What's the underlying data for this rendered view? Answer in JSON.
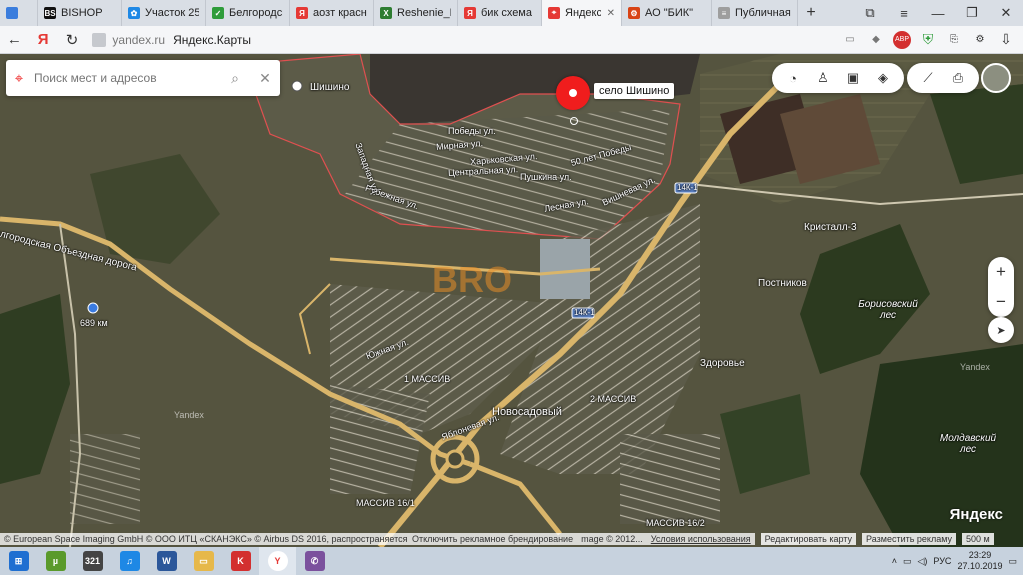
{
  "browser": {
    "tabs": [
      {
        "label": "",
        "favicon_color": "#3b7ddd",
        "favicon_text": ""
      },
      {
        "label": "BISHOP",
        "favicon_color": "#111111",
        "favicon_text": "BS"
      },
      {
        "label": "Участок 25",
        "favicon_color": "#1e88e5",
        "favicon_text": "✿"
      },
      {
        "label": "Белгородск",
        "favicon_color": "#2e9c3a",
        "favicon_text": "✓"
      },
      {
        "label": "аозт красн",
        "favicon_color": "#e53935",
        "favicon_text": "Я"
      },
      {
        "label": "Reshenie_Be",
        "favicon_color": "#2e7d32",
        "favicon_text": "X"
      },
      {
        "label": "бик схема",
        "favicon_color": "#e53935",
        "favicon_text": "Я"
      },
      {
        "label": "Яндекс.К",
        "favicon_color": "#e53935",
        "favicon_text": "⌖"
      },
      {
        "label": "АО \"БИК\"",
        "favicon_color": "#d84315",
        "favicon_text": "⚙"
      },
      {
        "label": "Публичная",
        "favicon_color": "#9e9e9e",
        "favicon_text": "≡"
      }
    ],
    "active_tab_index": 7,
    "new_tab_symbol": "+",
    "url_domain": "yandex.ru",
    "page_title": "Яндекс.Карты",
    "abp_label": "ABP"
  },
  "map": {
    "search_placeholder": "Поиск мест и адресов",
    "selected_place": "село Шишино",
    "labels": {
      "shishino": "Шишино",
      "bypass": "Белгородская Объездная дорога",
      "km689": "689 км",
      "kristall": "Кристалл-3",
      "postnikov": "Постников",
      "borisovsky": "Борисовский лес",
      "zdorovye": "Здоровье",
      "moldavsky": "Молдавский лес",
      "novosadovy": "Новосадовый",
      "massiv1": "1 МАССИВ",
      "massiv2": "2 МАССИВ",
      "massiv16_1": "МАССИВ 16/1",
      "massiv16_2": "МАССИВ 16/2",
      "road14k1": "14К-1",
      "road14k1b": "14К-1",
      "yandex_watermark": "Yandex",
      "yandex_watermark2": "Yandex",
      "street_pobedy": "50 лет Победы",
      "street_mirnaya": "Мирная ул.",
      "street_kharkovskaya": "Харьковская ул.",
      "street_tsentralnaya": "Центральная ул.",
      "street_pushkina": "Пушкина ул.",
      "street_bedy": "Победы ул.",
      "street_lesnaya": "Лесная ул.",
      "street_rubezhnaya": "Рубежная ул.",
      "street_vishnevaya": "Вишневая ул.",
      "street_zapadnaya": "Западная ул.",
      "street_yuzhnaya": "Южная ул.",
      "street_yablonevaya": "Яблоневая ул."
    },
    "watermark_text": "BRO",
    "logo": "Яндекс",
    "copyright": "© European Space Imaging GmbH © ООО ИТЦ «СКАНЭКС» © Airbus DS 2016, распространяется",
    "ad_toggle": "Отключить рекламное брендирование",
    "image_year": "mage © 2012...",
    "terms": "Условия использования",
    "edit_map": "Редактировать карту",
    "ad_placement": "Разместить рекламу",
    "scale": "500 м",
    "zoom_in": "+",
    "zoom_out": "−"
  },
  "taskbar": {
    "language": "РУС",
    "time": "23:29",
    "date": "27.10.2019",
    "apps": [
      {
        "name": "windows-start",
        "color": "#1f6fd1",
        "text": "⊞"
      },
      {
        "name": "utorrent",
        "color": "#5a9a2b",
        "text": "µ"
      },
      {
        "name": "calendar-321",
        "color": "#444444",
        "text": "321"
      },
      {
        "name": "music-app",
        "color": "#1e88e5",
        "text": "♫"
      },
      {
        "name": "word",
        "color": "#2b579a",
        "text": "W"
      },
      {
        "name": "explorer",
        "color": "#e6b84a",
        "text": "▭"
      },
      {
        "name": "kaspersky",
        "color": "#d32f2f",
        "text": "K"
      },
      {
        "name": "yandex-browser",
        "color": "#ffffff",
        "text": "Y"
      },
      {
        "name": "viber",
        "color": "#7b519d",
        "text": "✆"
      }
    ],
    "active_app_index": 7
  }
}
